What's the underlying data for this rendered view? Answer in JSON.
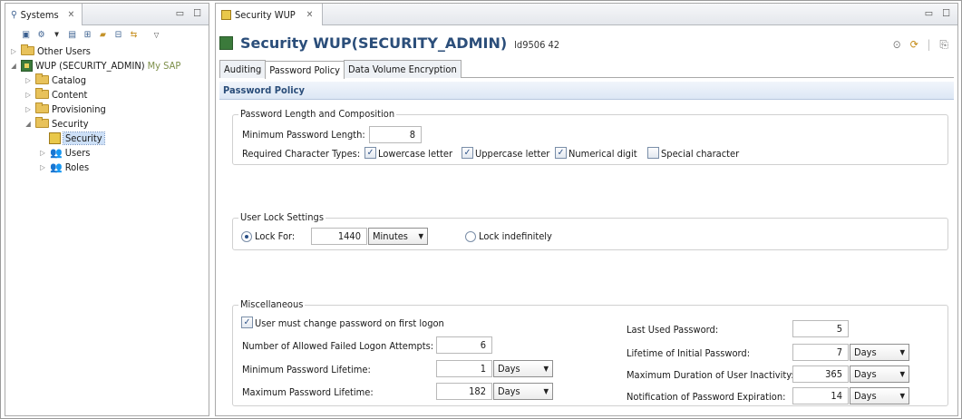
{
  "systems_view": {
    "tab_title": "Systems",
    "close_glyph": "✕",
    "tree": {
      "other_users": "Other Users",
      "system_label": "WUP (SECURITY_ADMIN)",
      "system_hint": "My SAP",
      "catalog": "Catalog",
      "content": "Content",
      "provisioning": "Provisioning",
      "security": "Security",
      "security_selected": "Security",
      "users": "Users",
      "roles": "Roles"
    }
  },
  "editor": {
    "tab_title": "Security WUP",
    "close_glyph": "✕",
    "header_title": "Security WUP(SECURITY_ADMIN)",
    "header_sub": "ld9506 42",
    "subtabs": [
      "Auditing",
      "Password Policy",
      "Data Volume Encryption"
    ],
    "active_subtab": "Password Policy",
    "section_title": "Password Policy"
  },
  "password_length": {
    "legend": "Password Length and Composition",
    "min_length_label": "Minimum Password Length:",
    "min_length_value": "8",
    "required_types_label": "Required Character Types:",
    "types": [
      {
        "label": "Lowercase letter",
        "checked": true
      },
      {
        "label": "Uppercase letter",
        "checked": true
      },
      {
        "label": "Numerical digit",
        "checked": true
      },
      {
        "label": "Special character",
        "checked": false
      }
    ]
  },
  "user_lock": {
    "legend": "User Lock Settings",
    "lock_for_label": "Lock For:",
    "lock_for_value": "1440",
    "lock_for_unit": "Minutes",
    "lock_indef_label": "Lock indefinitely",
    "selected": "lock_for"
  },
  "misc": {
    "legend": "Miscellaneous",
    "must_change_label": "User must change password on first logon",
    "must_change_checked": true,
    "failed_attempts_label": "Number of Allowed Failed Logon Attempts:",
    "failed_attempts_value": "6",
    "min_lifetime_label": "Minimum Password Lifetime:",
    "min_lifetime_value": "1",
    "min_lifetime_unit": "Days",
    "max_lifetime_label": "Maximum Password Lifetime:",
    "max_lifetime_value": "182",
    "max_lifetime_unit": "Days",
    "last_used_label": "Last Used Password:",
    "last_used_value": "5",
    "initial_lifetime_label": "Lifetime of Initial Password:",
    "initial_lifetime_value": "7",
    "initial_lifetime_unit": "Days",
    "inactivity_label": "Maximum Duration of User Inactivity:",
    "inactivity_value": "365",
    "inactivity_unit": "Days",
    "notification_label": "Notification of Password Expiration:",
    "notification_value": "14",
    "notification_unit": "Days"
  },
  "glyphs": {
    "minimize": "▭",
    "maximize": "☐",
    "twisty_closed": "▷",
    "twisty_open": "◢",
    "dropdown": "▼",
    "check": "✓"
  }
}
